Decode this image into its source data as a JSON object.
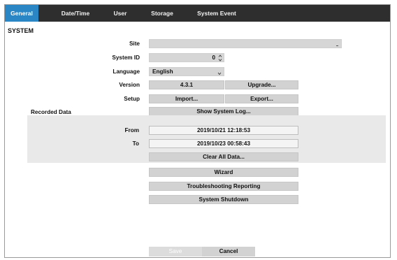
{
  "tabs": [
    {
      "label": "General",
      "active": true
    },
    {
      "label": "Date/Time",
      "active": false
    },
    {
      "label": "User",
      "active": false
    },
    {
      "label": "Storage",
      "active": false
    },
    {
      "label": "System Event",
      "active": false
    }
  ],
  "section": {
    "title": "SYSTEM"
  },
  "fields": {
    "site": {
      "label": "Site",
      "value": ""
    },
    "system_id": {
      "label": "System ID",
      "value": "0"
    },
    "language": {
      "label": "Language",
      "value": "English"
    },
    "version": {
      "label": "Version",
      "value": "4.3.1",
      "upgrade_label": "Upgrade..."
    },
    "setup": {
      "label": "Setup",
      "import_label": "Import...",
      "export_label": "Export..."
    }
  },
  "recorded_data": {
    "label": "Recorded Data",
    "show_log_label": "Show System Log...",
    "from_label": "From",
    "from_value": "2019/10/21  12:18:53",
    "to_label": "To",
    "to_value": "2019/10/23  00:58:43",
    "clear_label": "Clear All Data..."
  },
  "actions": {
    "wizard": "Wizard",
    "troubleshooting": "Troubleshooting Reporting",
    "shutdown": "System Shutdown"
  },
  "footer": {
    "save_label": "Save",
    "cancel_label": "Cancel",
    "save_disabled": true
  },
  "colors": {
    "tabbar": "#2e2e2e",
    "active_tab": "#2b86c6",
    "field_bg": "#d6d6d6",
    "panel_bg": "#e9e9e9"
  }
}
